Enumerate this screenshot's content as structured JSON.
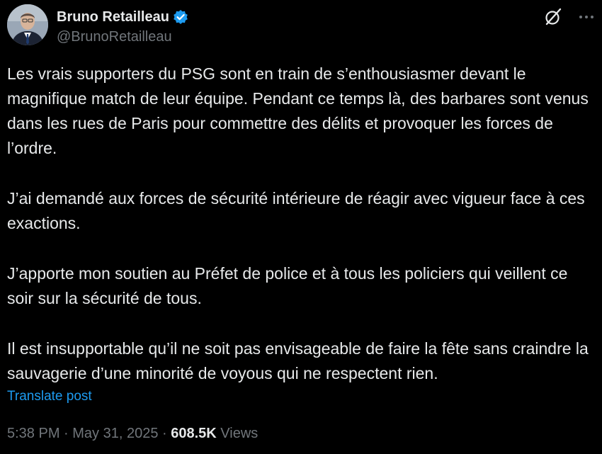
{
  "author": {
    "display_name": "Bruno Retailleau",
    "handle": "@BrunoRetailleau",
    "verified_icon": "verified-badge-icon",
    "verified_color": "#1d9bf0"
  },
  "header_actions": {
    "grok_icon": "grok-icon",
    "more_icon": "more-options-icon"
  },
  "post": {
    "paragraphs": [
      "Les vrais supporters du PSG sont en train de s’enthousiasmer devant le magnifique match de leur équipe. Pendant ce temps là, des barbares sont venus dans les rues de Paris pour commettre des délits et provoquer les forces de l’ordre.",
      "J’ai demandé aux forces de sécurité intérieure de réagir avec vigueur face à ces exactions.",
      "J’apporte mon soutien au Préfet de police et à tous les policiers qui veillent ce soir sur la sécurité de tous.",
      "Il est insupportable qu’il ne soit pas envisageable de faire la fête sans craindre la sauvagerie d’une minorité de voyous qui ne respectent rien."
    ],
    "translate_label": "Translate post"
  },
  "meta": {
    "time": "5:38 PM",
    "separator": " · ",
    "date": "May 31, 2025",
    "views_count": "608.5K",
    "views_label": " Views"
  },
  "colors": {
    "background": "#000000",
    "text": "#e7e9ea",
    "secondary": "#71767b",
    "accent": "#1d9bf0"
  }
}
